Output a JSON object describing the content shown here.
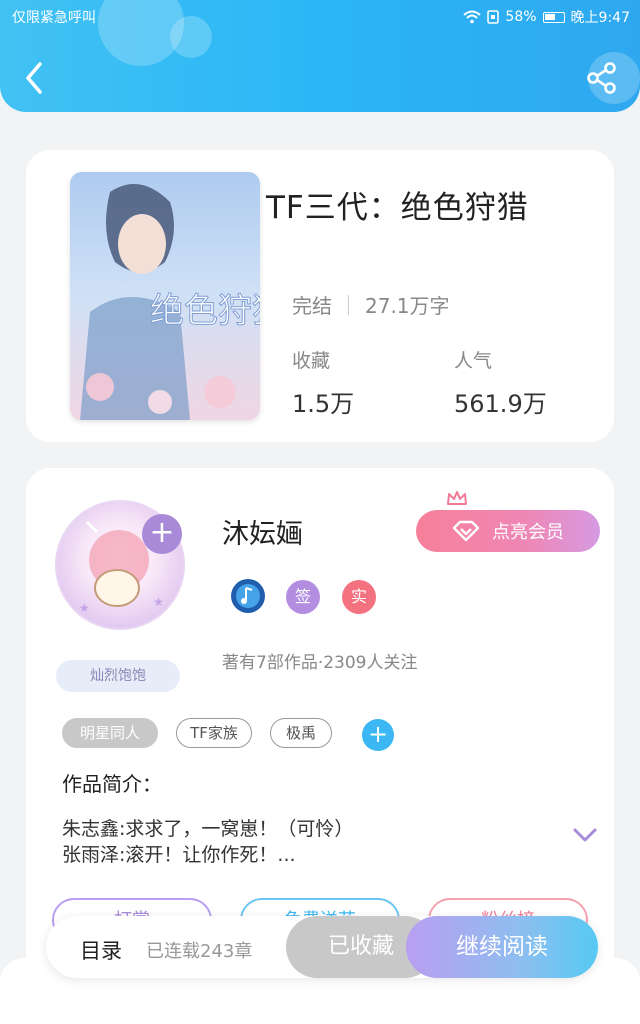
{
  "status_bar": {
    "left_text": "仅限紧急呼叫",
    "battery": "58%",
    "time": "晚上9:47"
  },
  "header": {
    "back_icon": "chevron-left-icon",
    "share_icon": "share-icon"
  },
  "book": {
    "title": "TF三代：绝色狩猎",
    "status": "完结",
    "word_count": "27.1万字",
    "favorites_label": "收藏",
    "favorites_value": "1.5万",
    "popularity_label": "人气",
    "popularity_value": "561.9万",
    "cover_title": "绝色狩猎"
  },
  "author": {
    "name": "沐妘婳",
    "badge": "灿烈饱饱",
    "vip_button": "点亮会员",
    "sign_badge": "签",
    "real_badge": "实",
    "info": "著有7部作品·2309人关注"
  },
  "tags": [
    "明星同人",
    "TF家族",
    "极禹"
  ],
  "intro": {
    "heading": "作品简介：",
    "lines": [
      "朱志鑫:求求了，一窝崽！（可怜）",
      "张雨泽:滚开！让你作死！..."
    ]
  },
  "actions": [
    "打赏",
    "免费送花",
    "粉丝榜"
  ],
  "bottom_bar": {
    "toc": "目录",
    "serial": "已连载243章",
    "collected": "已收藏",
    "continue": "继续阅读"
  },
  "colors": {
    "header": "#2ab6f6",
    "accent_purple": "#a88ad9",
    "vip_pink": "#f7809a",
    "accent_blue": "#3bb8f3"
  }
}
